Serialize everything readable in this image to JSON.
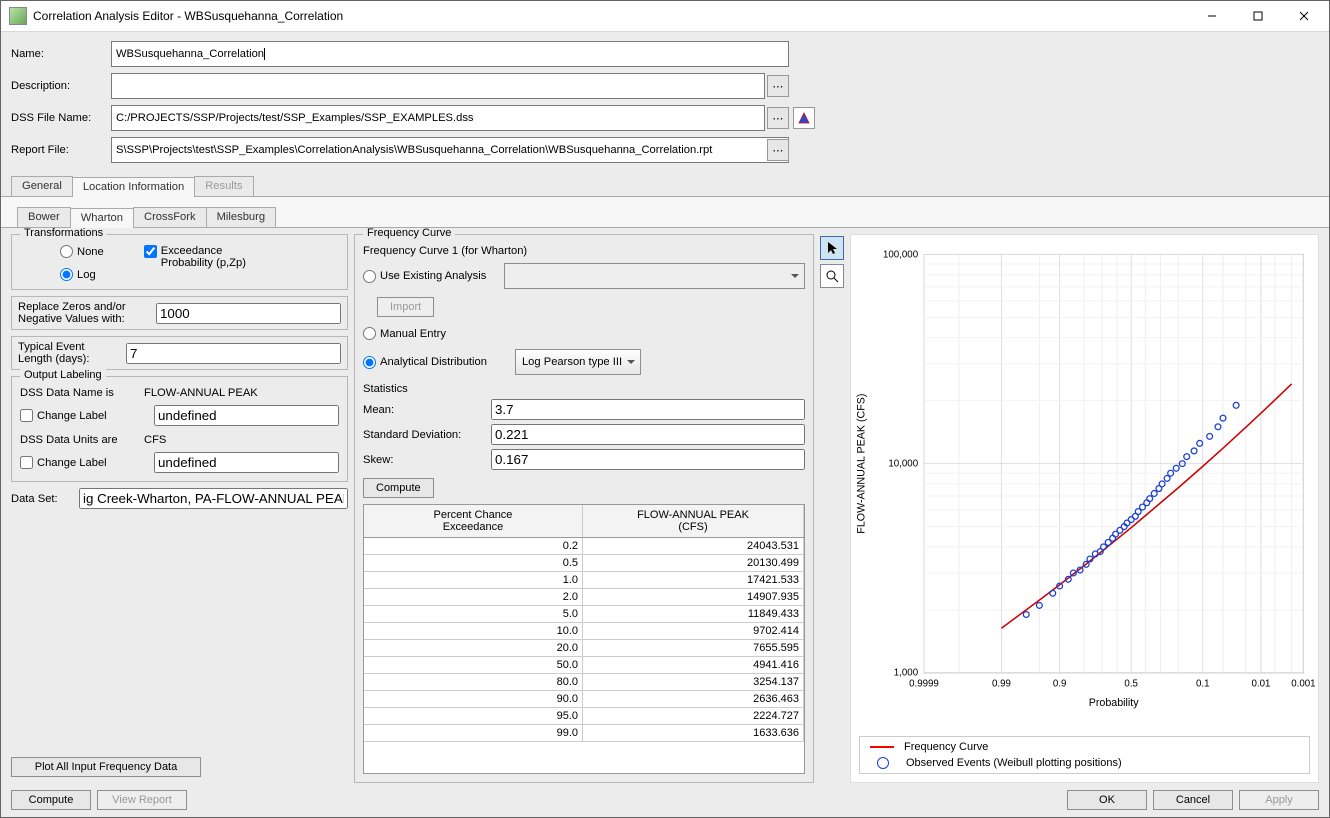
{
  "window": {
    "title": "Correlation Analysis Editor - WBSusquehanna_Correlation"
  },
  "form": {
    "name_label": "Name:",
    "name_value": "WBSusquehanna_Correlation",
    "desc_label": "Description:",
    "desc_value": "",
    "dss_label": "DSS File Name:",
    "dss_value": "C:/PROJECTS/SSP/Projects/test/SSP_Examples/SSP_EXAMPLES.dss",
    "rpt_label": "Report File:",
    "rpt_value": "S\\SSP\\Projects\\test\\SSP_Examples\\CorrelationAnalysis\\WBSusquehanna_Correlation\\WBSusquehanna_Correlation.rpt"
  },
  "tabs_main": [
    "General",
    "Location Information",
    "Results"
  ],
  "tabs_main_active": 1,
  "tabs_loc": [
    "Bower",
    "Wharton",
    "CrossFork",
    "Milesburg"
  ],
  "tabs_loc_active": 1,
  "transform": {
    "legend": "Transformations",
    "none": "None",
    "log": "Log",
    "exceed": "Exceedance Probability (p,Zp)"
  },
  "replace": {
    "label1": "Replace Zeros and/or",
    "label2": "Negative Values with:",
    "value": "1000"
  },
  "typical": {
    "label1": "Typical Event",
    "label2": "Length (days):",
    "value": "7"
  },
  "outlabel": {
    "legend": "Output Labeling",
    "dssname_is": "DSS Data Name is",
    "dssname_val": "FLOW-ANNUAL PEAK",
    "change_label": "Change Label",
    "undef": "undefined",
    "dssunits_are": "DSS Data Units are",
    "units_val": "CFS"
  },
  "dataset": {
    "label": "Data Set:",
    "value": "ig Creek-Wharton, PA-FLOW-ANNUAL PEAK"
  },
  "plotall": "Plot All Input Frequency Data",
  "freq": {
    "legend": "Frequency Curve",
    "curve_for": "Frequency Curve 1 (for Wharton)",
    "use_existing": "Use Existing Analysis",
    "import": "Import",
    "manual": "Manual Entry",
    "analytical": "Analytical Distribution",
    "dist_selected": "Log Pearson type III",
    "stats": "Statistics",
    "mean_label": "Mean:",
    "mean": "3.7",
    "sd_label": "Standard Deviation:",
    "sd": "0.221",
    "skew_label": "Skew:",
    "skew": "0.167",
    "compute": "Compute",
    "col1a": "Percent Chance",
    "col1b": "Exceedance",
    "col2a": "FLOW-ANNUAL PEAK",
    "col2b": "(CFS)",
    "rows": [
      {
        "p": "0.2",
        "v": "24043.531"
      },
      {
        "p": "0.5",
        "v": "20130.499"
      },
      {
        "p": "1.0",
        "v": "17421.533"
      },
      {
        "p": "2.0",
        "v": "14907.935"
      },
      {
        "p": "5.0",
        "v": "11849.433"
      },
      {
        "p": "10.0",
        "v": "9702.414"
      },
      {
        "p": "20.0",
        "v": "7655.595"
      },
      {
        "p": "50.0",
        "v": "4941.416"
      },
      {
        "p": "80.0",
        "v": "3254.137"
      },
      {
        "p": "90.0",
        "v": "2636.463"
      },
      {
        "p": "95.0",
        "v": "2224.727"
      },
      {
        "p": "99.0",
        "v": "1633.636"
      }
    ]
  },
  "footer": {
    "compute": "Compute",
    "view_report": "View Report",
    "ok": "OK",
    "cancel": "Cancel",
    "apply": "Apply"
  },
  "chart": {
    "ylabel": "FLOW-ANNUAL PEAK (CFS)",
    "xlabel": "Probability",
    "yticks": [
      "100,000",
      "10,000",
      "1,000"
    ],
    "xticks": [
      "0.9999",
      "0.99",
      "0.9",
      "0.5",
      "0.1",
      "0.01",
      "0.001"
    ],
    "legend_curve": "Frequency Curve",
    "legend_obs": "Observed Events (Weibull plotting positions)"
  },
  "chart_data": {
    "type": "line",
    "xlabel": "Probability",
    "ylabel": "FLOW-ANNUAL PEAK (CFS)",
    "yscale": "log",
    "xscale": "normal-probability",
    "ylim": [
      1000,
      100000
    ],
    "xticks": [
      0.9999,
      0.99,
      0.9,
      0.5,
      0.1,
      0.01,
      0.001
    ],
    "series": [
      {
        "name": "Frequency Curve",
        "style": "line",
        "color": "#d00000",
        "x": [
          0.99,
          0.95,
          0.9,
          0.8,
          0.5,
          0.2,
          0.1,
          0.05,
          0.02,
          0.01,
          0.005,
          0.002
        ],
        "y": [
          1633.636,
          2224.727,
          2636.463,
          3254.137,
          4941.416,
          7655.595,
          9702.414,
          11849.433,
          14907.935,
          17421.533,
          20130.499,
          24043.531
        ]
      },
      {
        "name": "Observed Events (Weibull plotting positions)",
        "style": "scatter",
        "color": "#1a3fd5",
        "x": [
          0.97,
          0.95,
          0.92,
          0.9,
          0.87,
          0.85,
          0.82,
          0.79,
          0.77,
          0.74,
          0.71,
          0.69,
          0.66,
          0.63,
          0.61,
          0.58,
          0.55,
          0.53,
          0.5,
          0.47,
          0.45,
          0.42,
          0.39,
          0.37,
          0.34,
          0.31,
          0.29,
          0.26,
          0.24,
          0.21,
          0.18,
          0.16,
          0.13,
          0.11,
          0.08,
          0.06,
          0.05,
          0.03
        ],
        "y": [
          1900,
          2100,
          2400,
          2600,
          2800,
          3000,
          3100,
          3300,
          3500,
          3700,
          3800,
          4000,
          4200,
          4400,
          4600,
          4800,
          5000,
          5200,
          5400,
          5600,
          5900,
          6200,
          6500,
          6800,
          7200,
          7600,
          8000,
          8500,
          9000,
          9500,
          10000,
          10800,
          11500,
          12500,
          13500,
          15000,
          16500,
          19000
        ]
      }
    ]
  }
}
